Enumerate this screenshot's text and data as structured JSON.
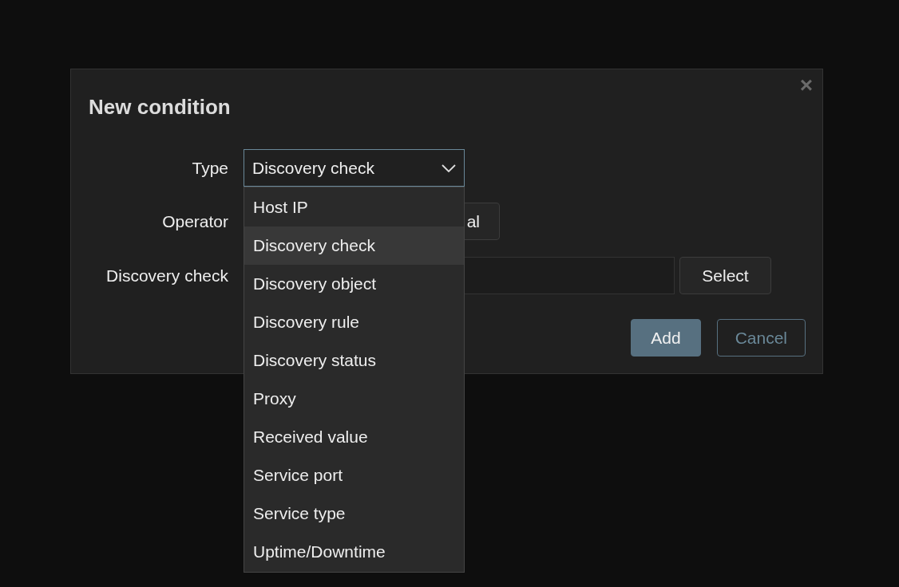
{
  "dialog": {
    "title": "New condition",
    "close": "×"
  },
  "form": {
    "type_label": "Type",
    "type_value": "Discovery check",
    "operator_label": "Operator",
    "operator_value": "al",
    "check_label": "Discovery check",
    "select_button": "Select"
  },
  "dropdown": {
    "expanded": true,
    "options": [
      {
        "label": "Host IP",
        "selected": false
      },
      {
        "label": "Discovery check",
        "selected": true
      },
      {
        "label": "Discovery object",
        "selected": false
      },
      {
        "label": "Discovery rule",
        "selected": false
      },
      {
        "label": "Discovery status",
        "selected": false
      },
      {
        "label": "Proxy",
        "selected": false
      },
      {
        "label": "Received value",
        "selected": false
      },
      {
        "label": "Service port",
        "selected": false
      },
      {
        "label": "Service type",
        "selected": false
      },
      {
        "label": "Uptime/Downtime",
        "selected": false
      }
    ]
  },
  "buttons": [
    {
      "label": "Add",
      "kind": "primary"
    },
    {
      "label": "Cancel",
      "kind": "secondary"
    }
  ]
}
